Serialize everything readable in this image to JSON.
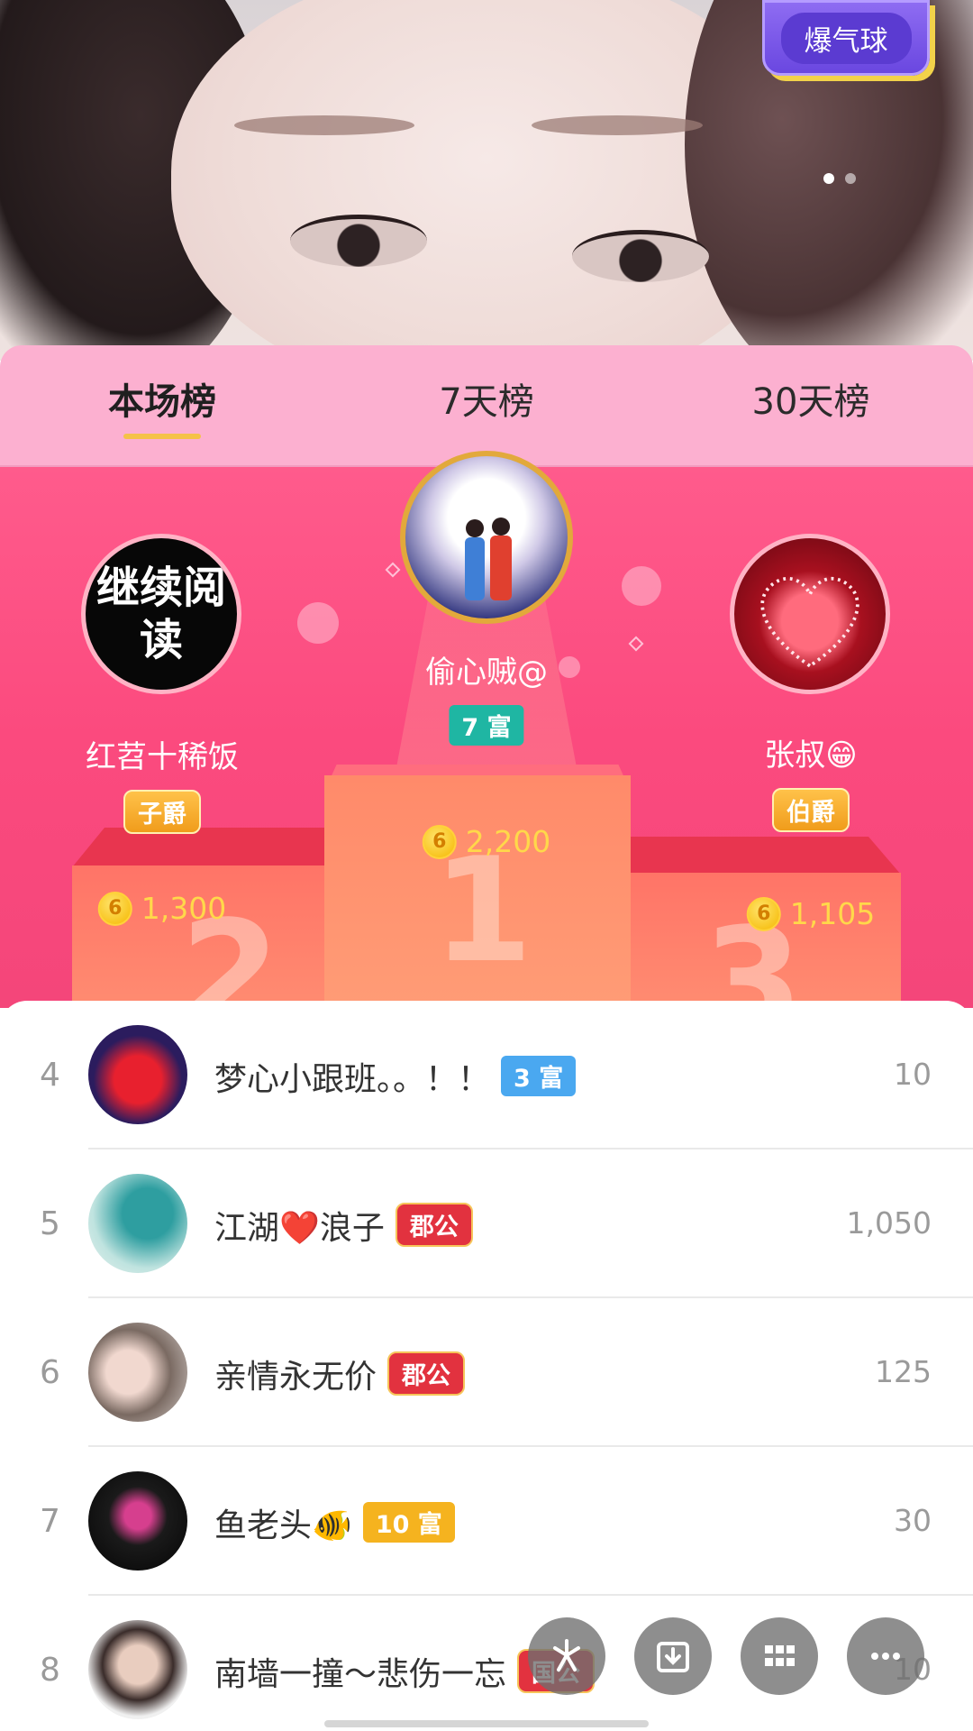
{
  "hero": {
    "boom_button": "爆气球",
    "carousel_dots": 2
  },
  "tabs": [
    "本场榜",
    "7天榜",
    "30天榜"
  ],
  "active_tab": 0,
  "podium": {
    "first": {
      "name": "偷心贼@",
      "badge": "7 富",
      "coins": "2,200",
      "rank": "1"
    },
    "second": {
      "name": "红苕十稀饭",
      "badge": "子爵",
      "coins": "1,300",
      "rank": "2",
      "avatar_text": "继续阅读"
    },
    "third": {
      "name": "张叔😁",
      "badge": "伯爵",
      "coins": "1,105",
      "rank": "3"
    }
  },
  "coin_icon_glyph": "6",
  "list": [
    {
      "rank": "4",
      "name": "梦心小跟班。。！！",
      "badge": "3 富",
      "badge_style": "blue",
      "value": "10"
    },
    {
      "rank": "5",
      "name": "江湖❤️浪子",
      "badge": "郡公",
      "badge_style": "red",
      "value": "1,050"
    },
    {
      "rank": "6",
      "name": "亲情永无价",
      "badge": "郡公",
      "badge_style": "red",
      "value": "125"
    },
    {
      "rank": "7",
      "name": "鱼老头🐠",
      "badge": "10 富",
      "badge_style": "yellow",
      "value": "30"
    },
    {
      "rank": "8",
      "name": "南墙一撞～悲伤一忘",
      "badge": "国公",
      "badge_style": "red",
      "value": "10"
    }
  ],
  "fab_icons": [
    "share-icon",
    "download-icon",
    "grid-icon",
    "more-icon"
  ],
  "colors": {
    "tab_bar": "#fcb0d0",
    "stage": "#ff5b8c",
    "accent_gold": "#f5c248",
    "coin_text": "#ffd84a"
  }
}
